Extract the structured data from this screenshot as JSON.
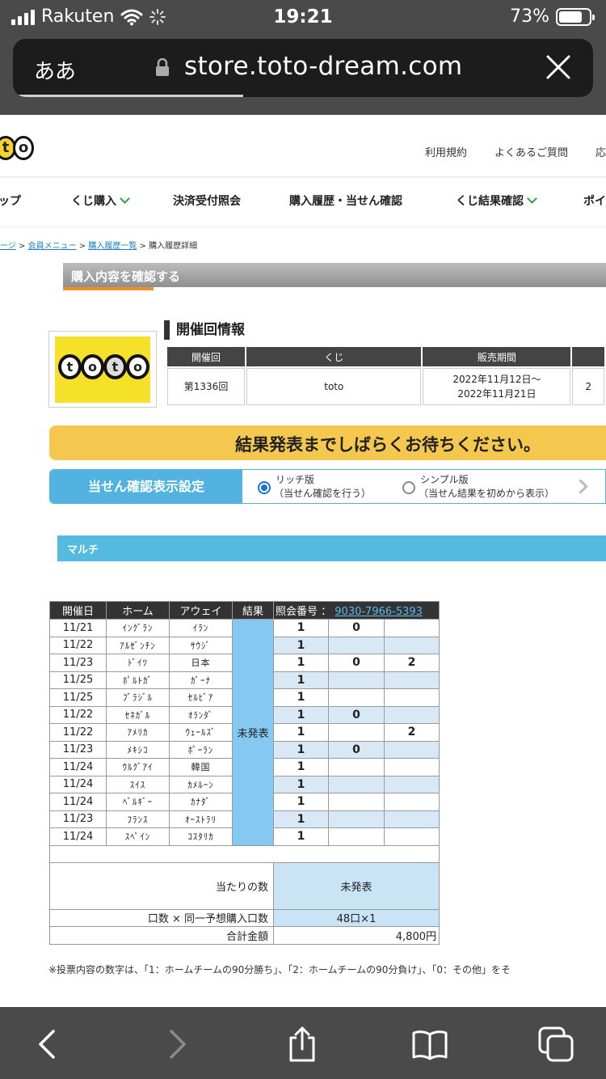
{
  "status": {
    "carrier": "Rakuten",
    "time": "19:21",
    "battery": "73%"
  },
  "browser": {
    "aa": "ああ",
    "url": "store.toto-dream.com"
  },
  "header": {
    "links": [
      "利用規約",
      "よくあるご質問",
      "応"
    ],
    "nav": [
      "ップ",
      "くじ購入",
      "決済受付照会",
      "購入履歴・当せん確認",
      "くじ結果確認",
      "ポイ"
    ]
  },
  "breadcrumb": {
    "items": [
      "ージ",
      "会員メニュー",
      "購入履歴一覧",
      "購入履歴詳細"
    ],
    "sep": ">"
  },
  "section_title": "購入内容を確認する",
  "logo_text": "toto",
  "event": {
    "title": "開催回情報",
    "headers": [
      "開催回",
      "くじ",
      "販売期間"
    ],
    "round": "第1336回",
    "lottery": "toto",
    "period_line1": "2022年11月12日～",
    "period_line2": "2022年11月21日",
    "extra_col": "2"
  },
  "banner": "結果発表までしばらくお待ちください。",
  "display_setting": {
    "label": "当せん確認表示設定",
    "rich_title": "リッチ版",
    "rich_sub": "（当せん確認を行う）",
    "simple_title": "シンプル版",
    "simple_sub": "（当せん結果を初めから表示）"
  },
  "multi_label": "マルチ",
  "purchase": {
    "headers": {
      "date": "開催日",
      "home": "ホーム",
      "away": "アウェイ",
      "result": "結果",
      "ref_label": "照会番号 ：",
      "ref_no": "9030-7966-5393"
    },
    "result_status": "未発表",
    "rows": [
      {
        "date": "11/21",
        "home": "ｲﾝｸﾞﾗﾝ",
        "away": "ｲﾗﾝ",
        "a": "1",
        "b": "0",
        "c": ""
      },
      {
        "date": "11/22",
        "home": "ｱﾙｾﾞﾝﾁﾝ",
        "away": "ｻｳｼﾞ",
        "a": "1",
        "b": "",
        "c": ""
      },
      {
        "date": "11/23",
        "home": "ﾄﾞｲﾂ",
        "away": "日本",
        "a": "1",
        "b": "0",
        "c": "2"
      },
      {
        "date": "11/25",
        "home": "ﾎﾟﾙﾄｶﾞ",
        "away": "ｶﾞｰﾅ",
        "a": "1",
        "b": "",
        "c": ""
      },
      {
        "date": "11/25",
        "home": "ﾌﾞﾗｼﾞﾙ",
        "away": "ｾﾙﾋﾞｱ",
        "a": "1",
        "b": "",
        "c": ""
      },
      {
        "date": "11/22",
        "home": "ｾﾈｶﾞﾙ",
        "away": "ｵﾗﾝﾀﾞ",
        "a": "1",
        "b": "0",
        "c": ""
      },
      {
        "date": "11/22",
        "home": "ｱﾒﾘｶ",
        "away": "ｳｪｰﾙｽﾞ",
        "a": "1",
        "b": "",
        "c": "2"
      },
      {
        "date": "11/23",
        "home": "ﾒｷｼｺ",
        "away": "ﾎﾟｰﾗﾝ",
        "a": "1",
        "b": "0",
        "c": ""
      },
      {
        "date": "11/24",
        "home": "ｳﾙｸﾞｱｲ",
        "away": "韓国",
        "a": "1",
        "b": "",
        "c": ""
      },
      {
        "date": "11/24",
        "home": "ｽｲｽ",
        "away": "ｶﾒﾙｰﾝ",
        "a": "1",
        "b": "",
        "c": ""
      },
      {
        "date": "11/24",
        "home": "ﾍﾞﾙｷﾞｰ",
        "away": "ｶﾅﾀﾞ",
        "a": "1",
        "b": "",
        "c": ""
      },
      {
        "date": "11/23",
        "home": "ﾌﾗﾝｽ",
        "away": "ｵｰｽﾄﾗﾘ",
        "a": "1",
        "b": "",
        "c": ""
      },
      {
        "date": "11/24",
        "home": "ｽﾍﾟｲﾝ",
        "away": "ｺｽﾀﾘｶ",
        "a": "1",
        "b": "",
        "c": ""
      }
    ],
    "wins_label": "当たりの数",
    "wins_value": "未発表",
    "units_label": "口数 × 同一予想購入口数",
    "units_value": "48口×1",
    "total_label": "合計金額",
    "total_value": "4,800円"
  },
  "footnote": "※投票内容の数字は、「1：ホームチームの90分勝ち」、「2：ホームチームの90分負け」、「0：その他」をそ"
}
